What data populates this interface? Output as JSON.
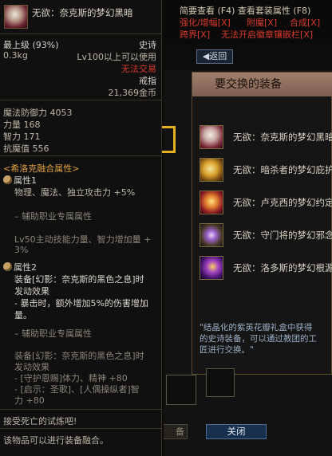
{
  "tooltip": {
    "item_name": "无欲：奈克斯的梦幻黑暗",
    "min_level": "最上级 (93%)",
    "rarity": "史诗",
    "weight": "0.3kg",
    "level_req": "Lv100以上可以使用",
    "trade": "无法交易",
    "slot": "戒指",
    "price": "21,369金币",
    "stats": [
      "魔法防御力 4053",
      "力量 168",
      "智力 171",
      "抗魔值 556"
    ],
    "fusion_title": "<希洛克融合属性>",
    "attr1_title": "属性1",
    "attr1_line": "物理、魔法、独立攻击力 +5%",
    "support1": "– 辅助职业专属属性",
    "attr1_skill": [
      "Lv50主动技能力量、智力增加量 +",
      "3%"
    ],
    "attr2_title": "属性2",
    "attr2_lines": [
      "装备[幻影：奈克斯的黑色之息]时",
      "发动效果",
      "- 暴击时，额外增加5%的伤害增加",
      "量。"
    ],
    "support2": "– 辅助职业专属属性",
    "attr2_support_lines": [
      "装备[幻影：奈克斯的黑色之息]时",
      "发动效果",
      "- [守护恩赐]体力、精神 +80",
      "- [启示：圣歌]、[人偶操纵者]智",
      "力 +80"
    ],
    "flavor": "接受死亡的试炼吧!",
    "footer": "该物品可以进行装备融合。"
  },
  "header": {
    "line1": "简要查看 (F4) 查看套装属性 (F8)",
    "line2a": "强化/增幅[X]",
    "line2b": "附魔[X]",
    "line2c": "合成[X]",
    "line3a": "跨界[X]",
    "line3b": "无法开启徽章镶嵌栏[X]"
  },
  "back_label": "◀返回",
  "exchange": {
    "title": "要交换的装备",
    "items": [
      {
        "label": "无欲：奈克斯的梦幻黑暗",
        "icon": "ring-icon"
      },
      {
        "label": "无欲：暗杀者的梦幻庇护",
        "icon": "ring-icon"
      },
      {
        "label": "无欲：卢克西的梦幻约定",
        "icon": "ring-icon"
      },
      {
        "label": "无欲：守门将的梦幻邪念",
        "icon": "ring-icon"
      },
      {
        "label": "无欲：洛多斯的梦幻根源",
        "icon": "ring-icon"
      }
    ],
    "description": "\"结晶化的紫英花瓣礼盒中获得的史诗装备，可以通过教团的工匠进行交换。\"",
    "close_label": "关闭",
    "cancel_label": "备"
  },
  "colors": {
    "accent_gold": "#e6b020",
    "title_bar": "#8f6f5e",
    "red_text": "#d83a2a"
  }
}
